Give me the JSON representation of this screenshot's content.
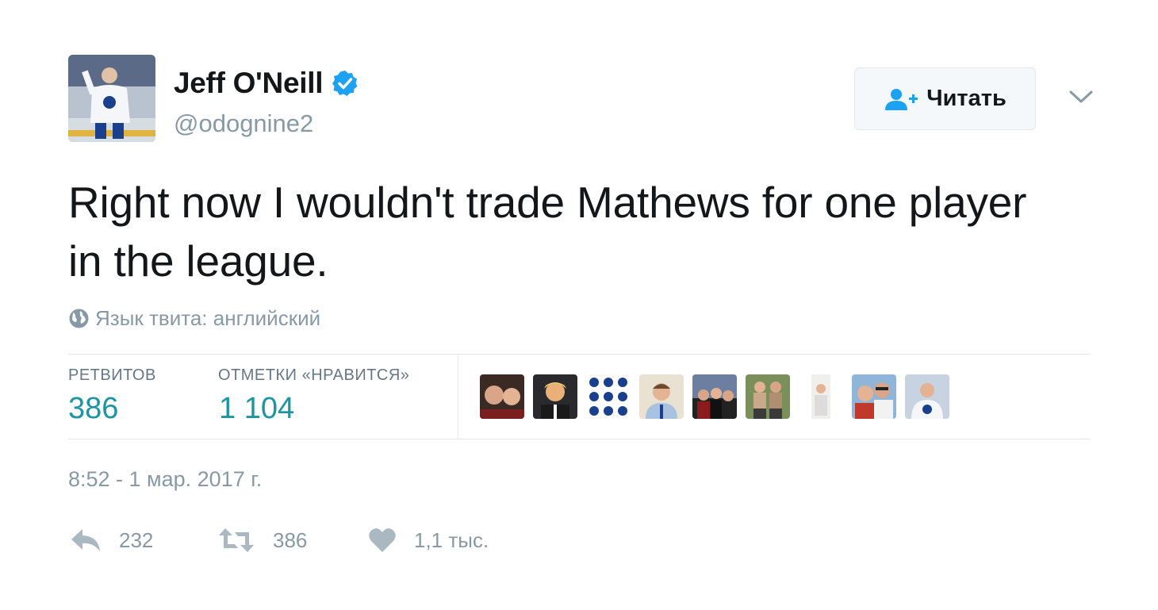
{
  "header": {
    "display_name": "Jeff O'Neill",
    "handle": "@odognine2",
    "avatar_icon": "avatar-player-icon",
    "verified_icon": "verified-badge-icon",
    "verified_color": "#1da1f2"
  },
  "follow_button": {
    "label": "Читать",
    "icon": "follow-user-icon",
    "icon_color": "#1da1f2"
  },
  "menu_icon": "chevron-down-icon",
  "tweet": {
    "text": "Right now I wouldn't trade Mathews for one player in the league.",
    "language_note": "Язык твита: английский",
    "language_icon": "globe-icon"
  },
  "stats": {
    "retweets_label": "РЕТВИТОВ",
    "retweets_value": "386",
    "likes_label": "ОТМЕТКИ «НРАВИТСЯ»",
    "likes_value": "1 104",
    "value_color": "#1b95a4"
  },
  "likers": [
    "liker-avatar-icon",
    "liker-avatar-icon",
    "liker-avatar-icon",
    "liker-avatar-icon",
    "liker-avatar-icon",
    "liker-avatar-icon",
    "liker-avatar-icon",
    "liker-avatar-icon",
    "liker-avatar-icon"
  ],
  "timestamp": "8:52 - 1 мар. 2017 г.",
  "actions": {
    "reply_count": "232",
    "retweet_count": "386",
    "like_count": "1,1 тыс.",
    "reply_icon": "reply-icon",
    "retweet_icon": "retweet-icon",
    "like_icon": "heart-icon",
    "icon_color": "#aab8c2"
  }
}
